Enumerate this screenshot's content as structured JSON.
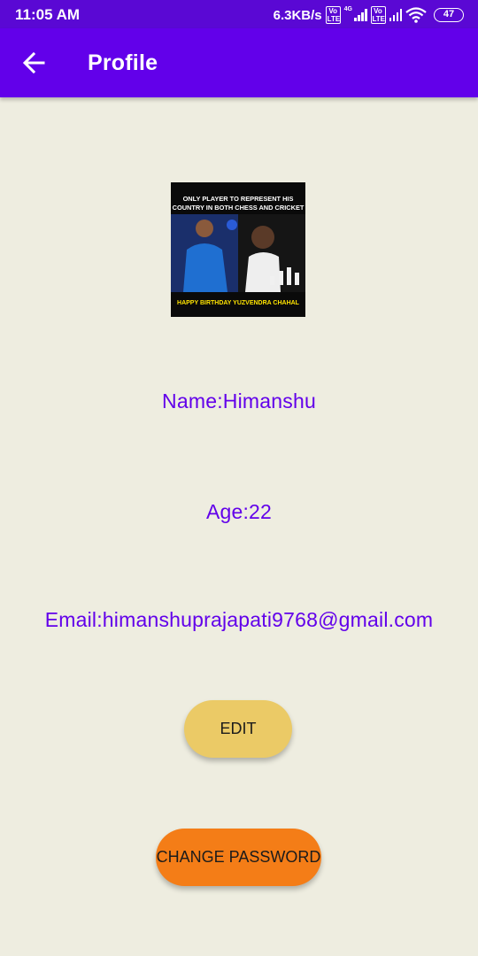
{
  "status_bar": {
    "time": "11:05 AM",
    "speed": "6.3KB/s",
    "volte_label": "Vo LTE",
    "network_type": "4G",
    "battery": "47"
  },
  "app_bar": {
    "title": "Profile",
    "back_icon": "arrow-back-icon"
  },
  "profile_image": {
    "headline": "ONLY PLAYER TO REPRESENT HIS\nCOUNTRY IN BOTH CHESS AND CRICKET",
    "footer": "HAPPY BIRTHDAY YUZVENDRA CHAHAL"
  },
  "profile": {
    "name": "Name:Himanshu",
    "age": "Age:22",
    "email": "Email:himanshuprajapati9768@gmail.com"
  },
  "buttons": {
    "edit": "EDIT",
    "change_password": "CHANGE PASSWORD"
  },
  "colors": {
    "status_bar": "#5a08d4",
    "app_bar": "#6200ea",
    "background": "#eeede0",
    "text_accent": "#6200ea",
    "edit_button": "#ebca66",
    "change_password_button": "#f47d17"
  }
}
